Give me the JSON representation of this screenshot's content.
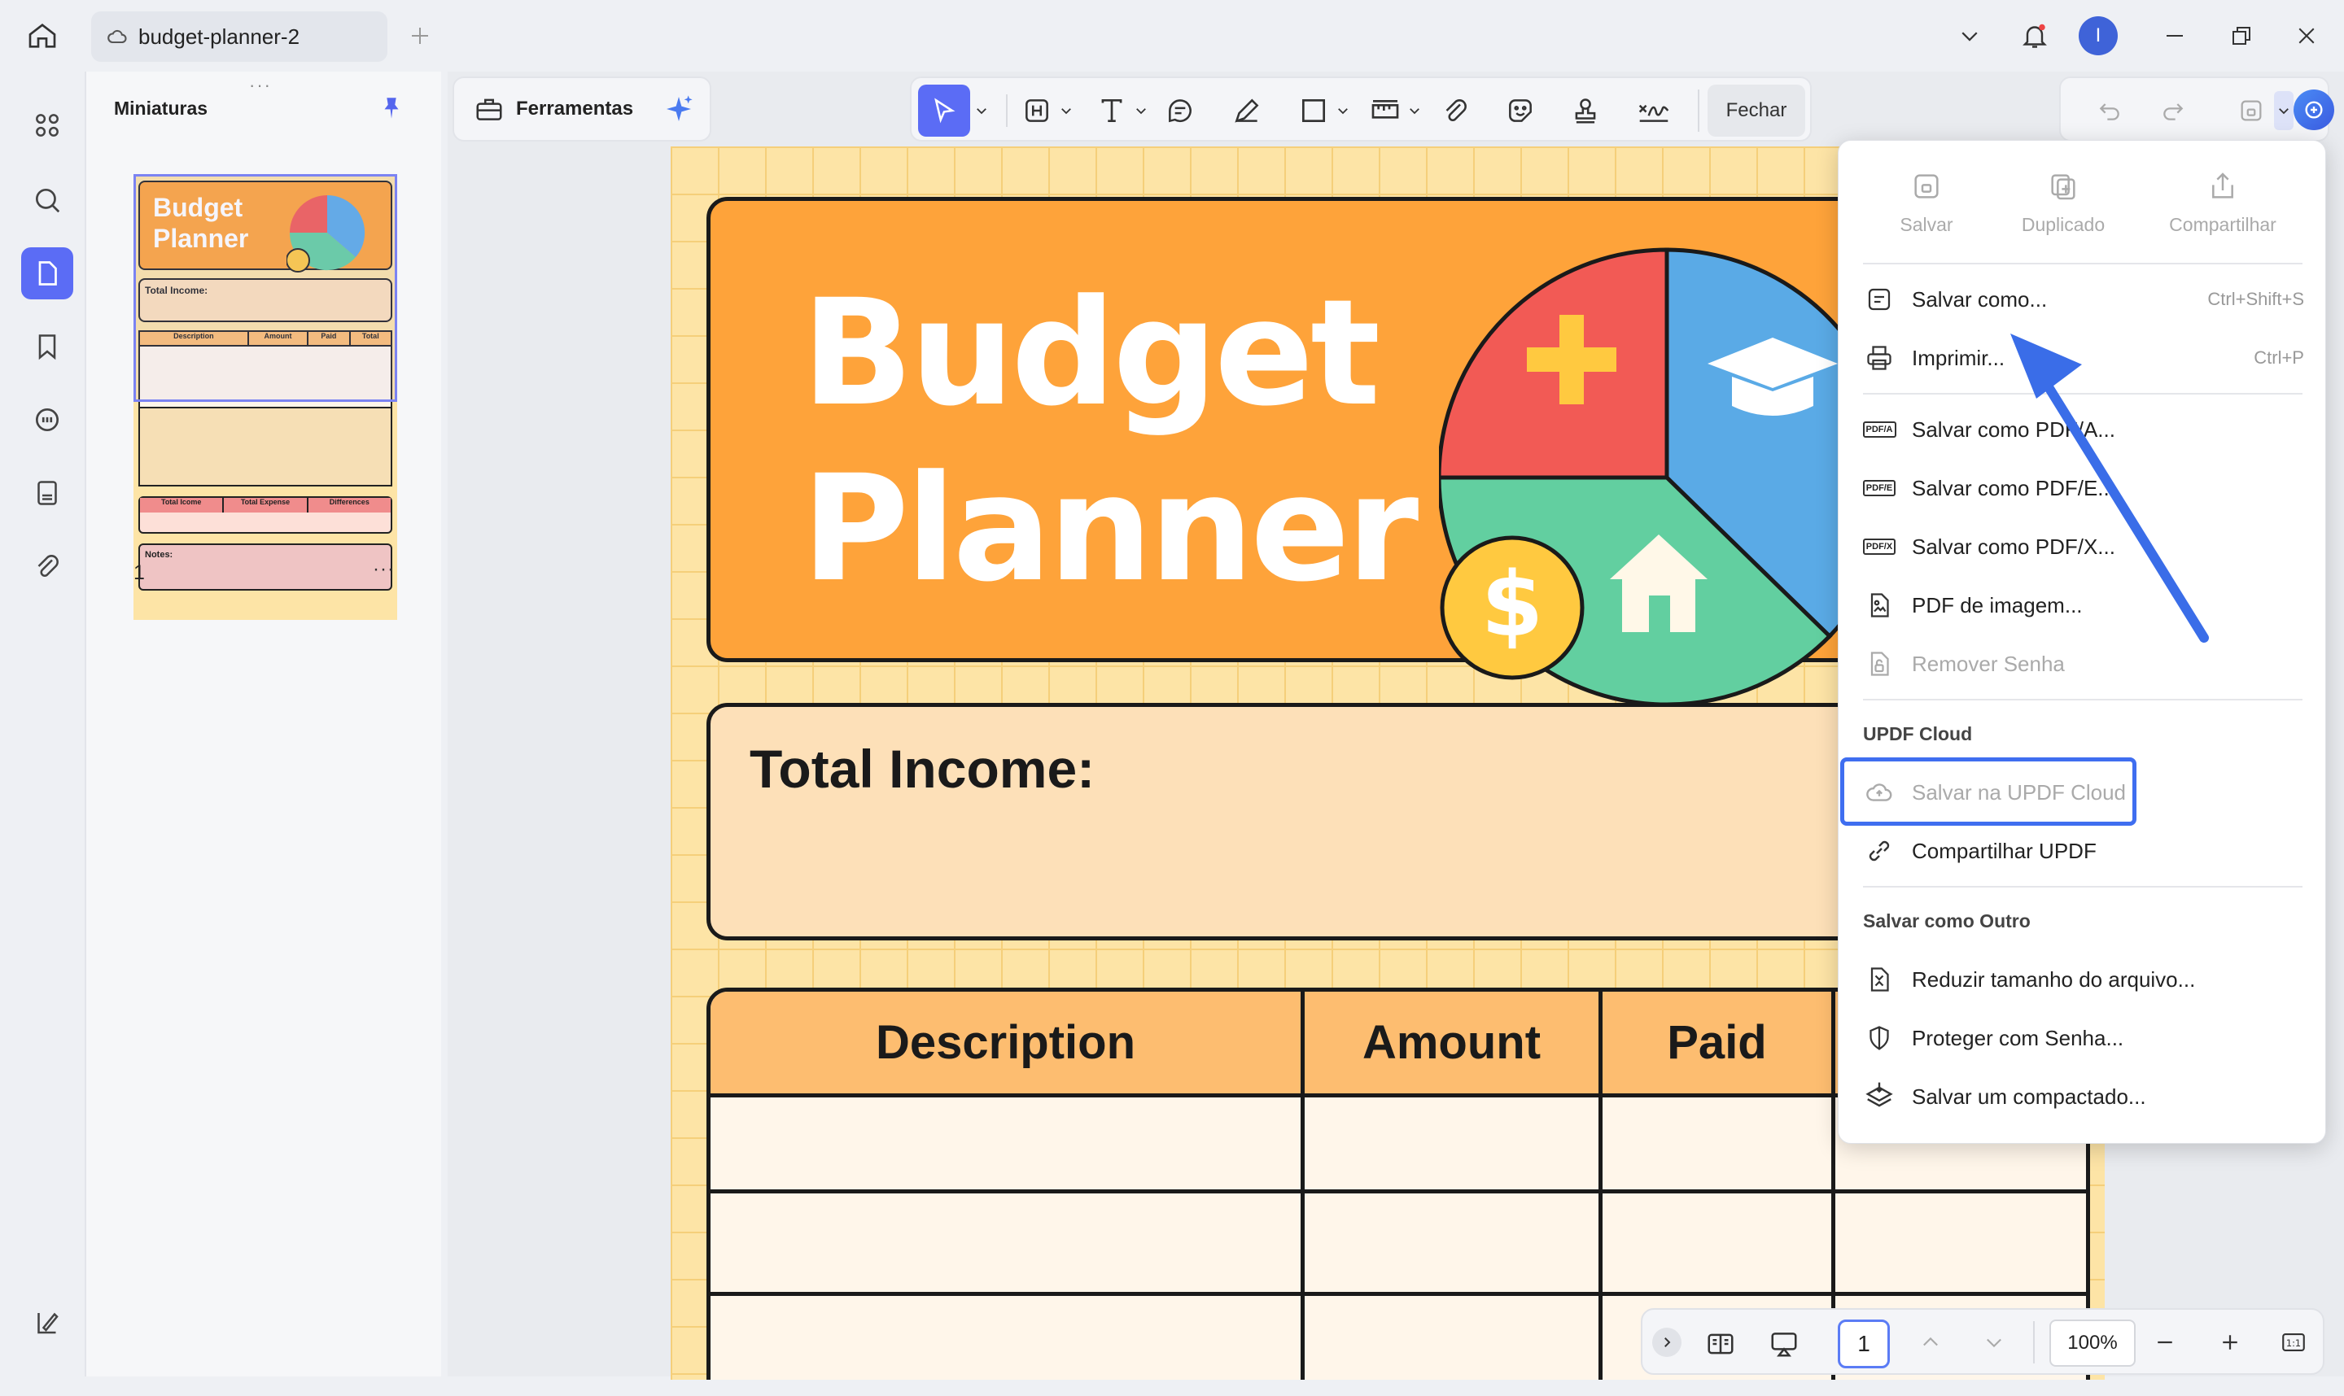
{
  "window": {
    "tab_title": "budget-planner-2",
    "user_initial": "I"
  },
  "thumbnails": {
    "title": "Miniaturas",
    "page_number": "1",
    "more": "···",
    "thumb_title_1": "Budget",
    "thumb_title_2": "Planner",
    "thumb_income": "Total Income:",
    "thumb_cols": [
      "Description",
      "Amount",
      "Paid",
      "Total"
    ],
    "thumb_summary": [
      "Total Icome",
      "Total Expense",
      "Differences"
    ],
    "thumb_notes": "Notes:"
  },
  "toolbar": {
    "tools_label": "Ferramentas",
    "close_label": "Fechar"
  },
  "document": {
    "title_line1": "Budget",
    "title_line2": "Planner",
    "income_label": "Total Income:",
    "columns": [
      "Description",
      "Amount",
      "Paid"
    ]
  },
  "menu": {
    "top_actions": [
      {
        "label": "Salvar"
      },
      {
        "label": "Duplicado"
      },
      {
        "label": "Compartilhar"
      }
    ],
    "items": [
      {
        "label": "Salvar como...",
        "shortcut": "Ctrl+Shift+S"
      },
      {
        "label": "Imprimir...",
        "shortcut": "Ctrl+P"
      },
      {
        "label": "Salvar como PDF/A...",
        "badge": "PDF/A"
      },
      {
        "label": "Salvar como PDF/E...",
        "badge": "PDF/E"
      },
      {
        "label": "Salvar como PDF/X...",
        "badge": "PDF/X"
      },
      {
        "label": "PDF de imagem..."
      },
      {
        "label": "Remover Senha"
      }
    ],
    "cloud_section": "UPDF Cloud",
    "cloud_items": [
      {
        "label": "Salvar na UPDF Cloud"
      },
      {
        "label": "Compartilhar UPDF"
      }
    ],
    "other_section": "Salvar como Outro",
    "other_items": [
      {
        "label": "Reduzir tamanho do arquivo..."
      },
      {
        "label": "Proteger com Senha..."
      },
      {
        "label": "Salvar um compactado..."
      }
    ]
  },
  "bottombar": {
    "page_input": "1",
    "zoom": "100%"
  },
  "colors": {
    "accent": "#4a6cf7",
    "orange": "#fea33a",
    "highlight_border": "#3f6ef0",
    "arrow": "#3a6de8"
  }
}
